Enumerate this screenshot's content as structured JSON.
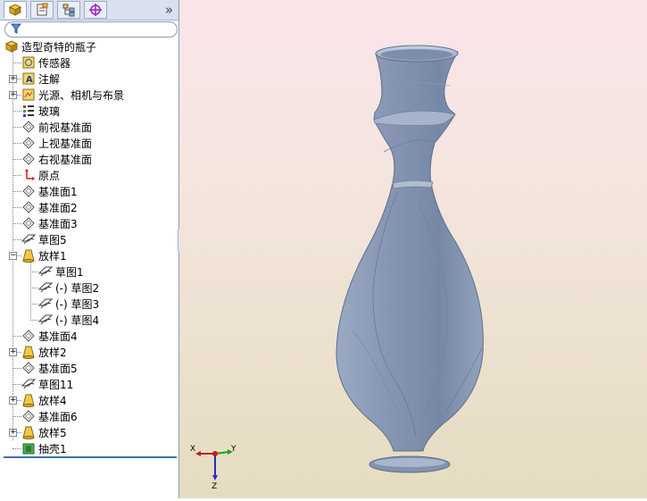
{
  "tabs": [
    {
      "name": "feature-manager"
    },
    {
      "name": "property-manager"
    },
    {
      "name": "configuration-manager"
    },
    {
      "name": "dimxpert-manager"
    }
  ],
  "tabbar": {
    "more": "»"
  },
  "tree": {
    "root": "造型奇特的瓶子",
    "items": [
      {
        "label": "传感器"
      },
      {
        "label": "注解"
      },
      {
        "label": "光源、相机与布景"
      },
      {
        "label": "玻璃"
      },
      {
        "label": "前视基准面"
      },
      {
        "label": "上视基准面"
      },
      {
        "label": "右视基准面"
      },
      {
        "label": "原点"
      },
      {
        "label": "基准面1"
      },
      {
        "label": "基准面2"
      },
      {
        "label": "基准面3"
      },
      {
        "label": "草图5"
      },
      {
        "label": "放样1"
      },
      {
        "label": "草图1"
      },
      {
        "label": "(-) 草图2"
      },
      {
        "label": "(-) 草图3"
      },
      {
        "label": "(-) 草图4"
      },
      {
        "label": "基准面4"
      },
      {
        "label": "放样2"
      },
      {
        "label": "基准面5"
      },
      {
        "label": "草图11"
      },
      {
        "label": "放样4"
      },
      {
        "label": "基准面6"
      },
      {
        "label": "放样5"
      },
      {
        "label": "抽壳1"
      }
    ]
  },
  "triad": {
    "x": "X",
    "y": "Y",
    "z": "Z"
  },
  "colors": {
    "model": "#8a9bb6",
    "bg_top": "#fbe5ea",
    "bg_bottom": "#e5dcc0"
  }
}
